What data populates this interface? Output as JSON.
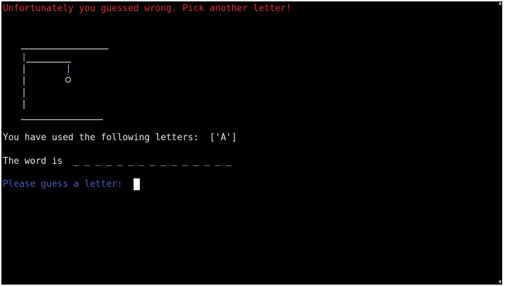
{
  "message": "Unfortunately you guessed wrong. Pick another letter!",
  "used_letters_label": "You have used the following letters:",
  "used_letters_value": "['A']",
  "word_label": "The word is",
  "word_display": "_ _ _ _ _ _ _ _ _ _ _ _ _ _ _",
  "prompt": "Please guess a letter:",
  "colors": {
    "error": "#e03030",
    "text": "#e8e8e8",
    "prompt": "#4a60b8",
    "background": "#000000"
  },
  "icons": {
    "scroll_up": "scroll-up-arrow-icon",
    "scroll_down": "scroll-down-arrow-icon"
  }
}
